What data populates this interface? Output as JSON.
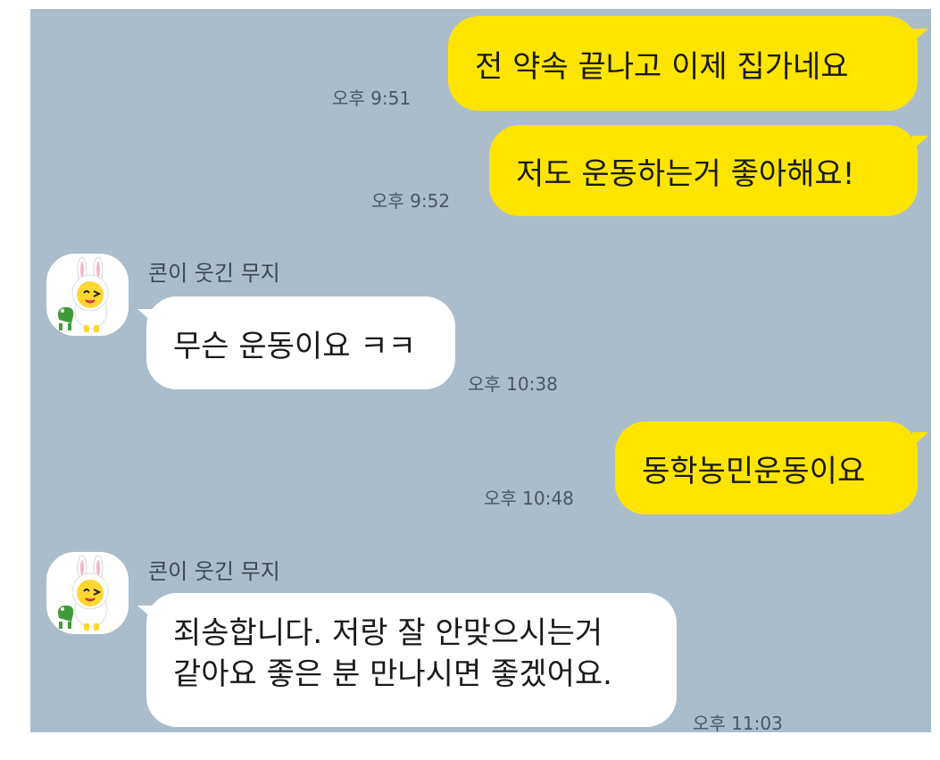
{
  "chat": {
    "background": "#abbdcb",
    "outgoing_color": "#fee500",
    "incoming_color": "#ffffff"
  },
  "messages": [
    {
      "direction": "out",
      "text": "전 약속 끝나고 이제 집가네요",
      "time": "오후 9:51"
    },
    {
      "direction": "out",
      "text": "저도 운동하는거 좋아해요!",
      "time": "오후 9:52"
    },
    {
      "direction": "in",
      "sender": "콘이 웃긴 무지",
      "avatar_icon": "muzi-rabbit-avatar-icon",
      "text": "무슨 운동이요 ㅋㅋ",
      "time": "오후 10:38"
    },
    {
      "direction": "out",
      "text": "동학농민운동이요",
      "time": "오후 10:48"
    },
    {
      "direction": "in",
      "sender": "콘이 웃긴 무지",
      "avatar_icon": "muzi-rabbit-avatar-icon",
      "lines": [
        "죄송합니다. 저랑 잘 안맞으시는거",
        "같아요 좋은 분 만나시면 좋겠어요."
      ],
      "time": "오후 11:03"
    }
  ]
}
